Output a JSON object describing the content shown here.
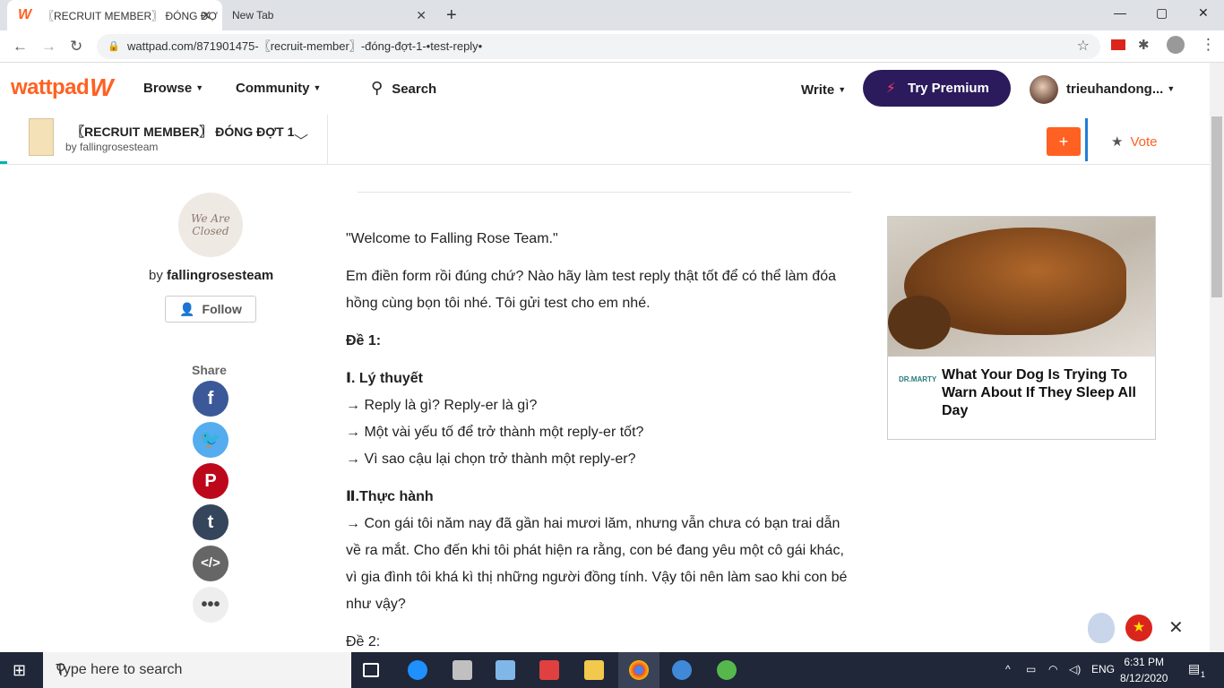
{
  "browser": {
    "tabs": [
      {
        "title": "〖RECRUIT MEMBER〗 ĐÓNG ĐỢ",
        "close": "✕"
      },
      {
        "title": "New Tab",
        "close": "✕"
      }
    ],
    "new_tab": "+",
    "url": "wattpad.com/871901475-〖recruit-member〗-đóng-đợt-1-•test-reply•",
    "window_buttons": [
      "—",
      "▢",
      "✕"
    ]
  },
  "wattpad": {
    "brand": "wattpad",
    "nav": {
      "browse": "Browse",
      "community": "Community",
      "search": "Search",
      "write": "Write",
      "premium": "Try Premium",
      "username": "trieuhandong..."
    },
    "story": {
      "title": "〖RECRUIT MEMBER〗 ĐÓNG ĐỢT 1",
      "by": "by fallingrosesteam",
      "add": "+",
      "vote": "Vote"
    },
    "author": {
      "avatar_text": "We Are Closed",
      "by_prefix": "by ",
      "name": "fallingrosesteam",
      "follow": "Follow"
    },
    "share": {
      "label": "Share",
      "icons": [
        "facebook-icon",
        "twitter-icon",
        "pinterest-icon",
        "tumblr-icon",
        "embed-icon",
        "more-icon"
      ]
    },
    "content": {
      "p1": "\"Welcome to Falling Rose Team.\"",
      "p2": "Em điền form rồi đúng chứ? Nào hãy làm test reply thật tốt để có thể làm đóa hồng cùng bọn tôi nhé. Tôi gửi test  cho em nhé.",
      "de1": "Đề 1:",
      "section1": "Ⅰ. Lý thuyết",
      "q1": "→ Reply là gì? Reply-er là gì?",
      "q2": "→ Một vài yếu tố để trở thành một reply-er tốt?",
      "q3": "→ Vì sao cậu lại chọn trở thành một reply-er?",
      "section2": "Ⅱ.Thực hành",
      "q4": "→ Con gái tôi năm nay đã gần hai mươi lăm, nhưng vẫn chưa có bạn trai dẫn về ra mắt. Cho đến khi tôi phát hiện ra rằng, con bé đang yêu một cô gái khác, vì gia đình tôi khá kì thị những người đồng tính. Vậy tôi nên làm sao khi con bé như vậy?",
      "de2": "Đề 2:"
    },
    "ad": {
      "logo": "DR.MARTY",
      "title": "What Your Dog Is Trying To Warn About If They Sleep All Day"
    }
  },
  "taskbar": {
    "search_placeholder": "Type here to search",
    "lang": "ENG",
    "time": "6:31 PM",
    "date": "8/12/2020",
    "notif": "1"
  },
  "colors": {
    "brand": "#ff6122",
    "premium": "#2b1b5c",
    "accent": "#00b2b2"
  }
}
